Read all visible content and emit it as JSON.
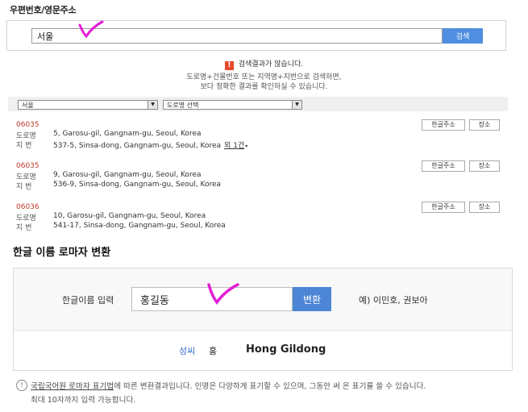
{
  "postcode": {
    "title": "우편번호/영문주소",
    "search_value": "서울",
    "search_button": "검색",
    "no_result": "검색결과가 않습니다.",
    "warn_icon": "exclamation-icon",
    "tip_line1": "도로명+건물번호 또는 지역명+지번으로 검색하면,",
    "tip_line2": "보다 정확한 결과를 확인하실 수 있습니다.",
    "filter_city": "서울",
    "filter_road": "도로명 선택",
    "btn_korean": "한글주소",
    "btn_map": "장소",
    "label_road": "도로명",
    "label_lot": "지  번",
    "results": [
      {
        "zip": "06035",
        "road": "5, Garosu-gil, Gangnam-gu, Seoul, Korea",
        "lot": "537-5, Sinsa-dong, Gangnam-gu, Seoul, Korea",
        "more": "외 1건"
      },
      {
        "zip": "06035",
        "road": "9, Garosu-gil, Gangnam-gu, Seoul, Korea",
        "lot": "536-9, Sinsa-dong, Gangnam-gu, Seoul, Korea",
        "more": ""
      },
      {
        "zip": "06036",
        "road": "10, Garosu-gil, Gangnam-gu, Seoul, Korea",
        "lot": "541-17, Sinsa-dong, Gangnam-gu, Seoul, Korea",
        "more": ""
      }
    ]
  },
  "romanize": {
    "title": "한글 이름 로마자 변환",
    "input_label": "한글이름 입력",
    "input_value": "홍길동",
    "convert_button": "변환",
    "example": "예) 이민호, 권보아",
    "surname_label": "성씨",
    "surname_value": "홍",
    "roman_value": "Hong Gildong"
  },
  "notes": {
    "link": "국립국어원 로마자 표기법",
    "line1_rest": "에 따른 변환결과입니다. 인명은 다양하게 표기할 수 있으며, 그동안 써 온 표기를 쓸 수 있습니다.",
    "line2": "최대 10자까지 입력 가능합니다.",
    "info_icon": "info-icon"
  },
  "colors": {
    "accent": "#4d86d6",
    "zip": "#c0392b",
    "annotation": "#e21fd6"
  }
}
